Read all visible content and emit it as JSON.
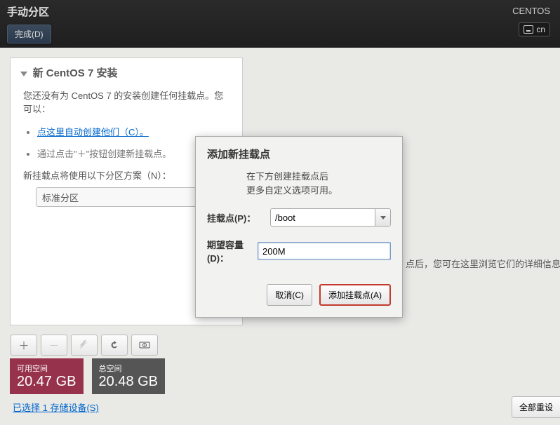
{
  "header": {
    "title": "手动分区",
    "product": "CENTOS",
    "kb_layout": "cn",
    "done_label": "完成(D)"
  },
  "panel": {
    "title": "新 CentOS 7 安装",
    "intro": "您还没有为 CentOS 7 的安装创建任何挂载点。您可以：",
    "auto_link": "点这里自动创建他们（C）。",
    "manual_hint": "通过点击\"＋\"按钮创建新挂载点。",
    "scheme_label": "新挂载点将使用以下分区方案（N）：",
    "scheme_value": "标准分区"
  },
  "hint": "点后，您可在这里浏览它们的详细信息。",
  "storage": {
    "avail_label": "可用空间",
    "avail_value": "20.47 GB",
    "total_label": "总空间",
    "total_value": "20.48 GB"
  },
  "selected_link": "已选择 1 存储设备(S)",
  "reset_label": "全部重设",
  "dialog": {
    "title": "添加新挂载点",
    "desc1": "在下方创建挂载点后",
    "desc2": "更多自定义选项可用。",
    "mount_label": "挂载点(P)：",
    "mount_value": "/boot",
    "size_label": "期望容量(D)：",
    "size_value": "200M",
    "cancel": "取消(C)",
    "confirm": "添加挂载点(A)"
  }
}
